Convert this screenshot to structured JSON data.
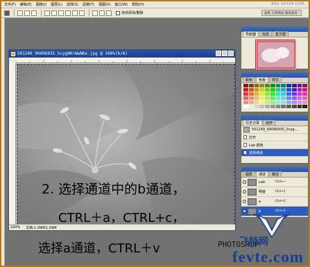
{
  "menu": {
    "items": [
      "文件(F)",
      "编辑(E)",
      "图像(I)",
      "图层(L)",
      "选择(S)",
      "滤镜(T)",
      "视图(V)",
      "窗口(W)",
      "帮助(H)"
    ]
  },
  "watermark_top": "BBS.16XX8.COM",
  "toolbar": {
    "auto_add_label": "自动添加/删除",
    "tab_well_label": "画笔 工具预设 图层复合"
  },
  "document": {
    "title": "501249_90096935_Scyg9KrWwNKe.jpg @ 100%(b/8)",
    "zoom": "100%",
    "doc_size": "文档:1.09M/1.09M"
  },
  "navigator": {
    "tabs": [
      "导航器",
      "信息",
      "直方图"
    ]
  },
  "swatches": {
    "tabs": [
      "颜色",
      "色板",
      "样式"
    ]
  },
  "history": {
    "tabs": [
      "历史记录",
      "动作"
    ],
    "items": [
      {
        "label": "501249_90096935_Scyg..."
      },
      {
        "label": "打开"
      },
      {
        "label": "Lab 颜色"
      },
      {
        "label": "选择通道"
      }
    ]
  },
  "channels": {
    "tabs": [
      "图层",
      "通道",
      "路径"
    ],
    "rows": [
      {
        "name": "Lab",
        "key": "Ctrl+~"
      },
      {
        "name": "明度",
        "key": "Ctrl+1"
      },
      {
        "name": "a",
        "key": "Ctrl+2"
      },
      {
        "name": "b",
        "key": "Ctrl+3"
      }
    ]
  },
  "overlay": {
    "line1": "2. 选择通道中的b通道，",
    "line2": "CTRL＋a，CTRL+c，",
    "line3": "选择a通道，CTRL＋v"
  },
  "brand": {
    "photo": "PHOTOSHOP",
    "cn": "飞特网",
    "site": "fevte.com"
  }
}
